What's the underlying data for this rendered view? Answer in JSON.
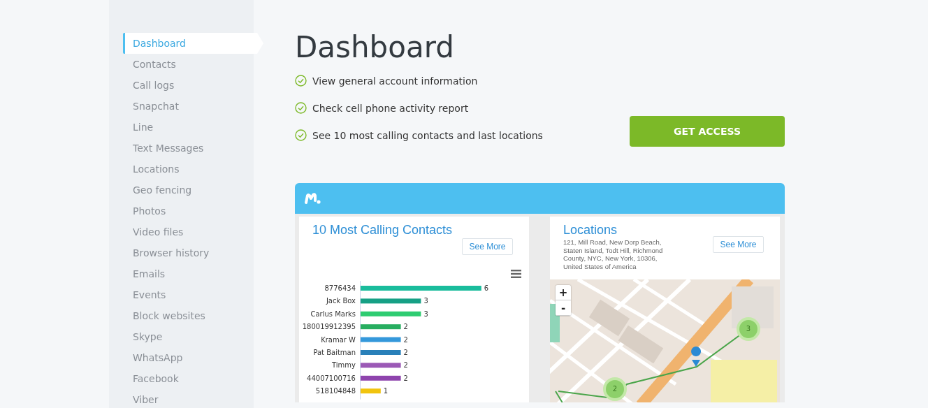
{
  "sidebar": {
    "items": [
      {
        "label": "Dashboard",
        "selected": true
      },
      {
        "label": "Contacts",
        "selected": false
      },
      {
        "label": "Call logs",
        "selected": false
      },
      {
        "label": "Snapchat",
        "selected": false
      },
      {
        "label": "Line",
        "selected": false
      },
      {
        "label": "Text Messages",
        "selected": false
      },
      {
        "label": "Locations",
        "selected": false
      },
      {
        "label": "Geo fencing",
        "selected": false
      },
      {
        "label": "Photos",
        "selected": false
      },
      {
        "label": "Video files",
        "selected": false
      },
      {
        "label": "Browser history",
        "selected": false
      },
      {
        "label": "Emails",
        "selected": false
      },
      {
        "label": "Events",
        "selected": false
      },
      {
        "label": "Block websites",
        "selected": false
      },
      {
        "label": "Skype",
        "selected": false
      },
      {
        "label": "WhatsApp",
        "selected": false
      },
      {
        "label": "Facebook",
        "selected": false
      },
      {
        "label": "Viber",
        "selected": false
      }
    ]
  },
  "page": {
    "title": "Dashboard",
    "features": [
      "View general account information",
      "Check cell phone activity report",
      "See 10 most calling contacts and last locations"
    ],
    "button": "GET ACCESS"
  },
  "preview": {
    "contacts_card": {
      "title": "10 Most Calling Contacts",
      "button": "See More",
      "chart_data": {
        "type": "bar",
        "orientation": "horizontal",
        "data_labels": true,
        "categories": [
          "8776434",
          "Jack Box",
          "Carlus Marks",
          "180019912395",
          "Kramar W",
          "Pat Baitman",
          "Timmy",
          "44007100716",
          "518104848"
        ],
        "series": [
          {
            "colors": [
              "#1abc9c",
              "#16a085",
              "#2ecc71",
              "#27ae60",
              "#3498db",
              "#2980b9",
              "#9b59b6",
              "#8e44ad",
              "#f1c40f"
            ],
            "values": [
              6,
              3,
              3,
              2,
              2,
              2,
              2,
              2,
              1
            ]
          }
        ]
      }
    },
    "locations_card": {
      "title": "Locations",
      "address": "121, Mill Road, New Dorp Beach, Staten Island, Todt Hill, Richmond County, NYC, New York, 10306, United States of America",
      "button": "See More",
      "map": {
        "kind": "picture",
        "zoom_in": "+",
        "zoom_out": "-",
        "clusters": [
          "3",
          "2"
        ]
      }
    }
  }
}
